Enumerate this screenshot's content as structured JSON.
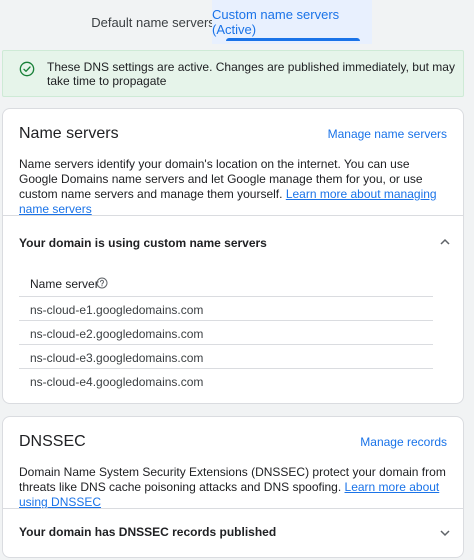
{
  "tabs": {
    "default": "Default name servers",
    "custom": "Custom name servers (Active)"
  },
  "banner": {
    "text": "These DNS settings are active. Changes are published immediately, but may take time to propagate"
  },
  "name_servers_card": {
    "title": "Name servers",
    "action": "Manage name servers",
    "description": "Name servers identify your domain's location on the internet. You can use Google Domains name servers and let Google manage them for you, or use custom name servers and manage them yourself.",
    "link": "Learn more about managing name servers",
    "section_title": "Your domain is using custom name servers",
    "column_header": "Name server",
    "servers": [
      "ns-cloud-e1.googledomains.com",
      "ns-cloud-e2.googledomains.com",
      "ns-cloud-e3.googledomains.com",
      "ns-cloud-e4.googledomains.com"
    ]
  },
  "dnssec_card": {
    "title": "DNSSEC",
    "action": "Manage records",
    "description": "Domain Name System Security Extensions (DNSSEC) protect your domain from threats like DNS cache poisoning attacks and DNS spoofing.",
    "link": "Learn more about using DNSSEC",
    "section_title": "Your domain has DNSSEC records published"
  },
  "colors": {
    "accent": "#1a73e8",
    "success": "#188038",
    "banner_bg": "#e6f4ea"
  },
  "icons": [
    "check-circle-icon",
    "help-icon",
    "chevron-up-icon",
    "chevron-down-icon"
  ]
}
